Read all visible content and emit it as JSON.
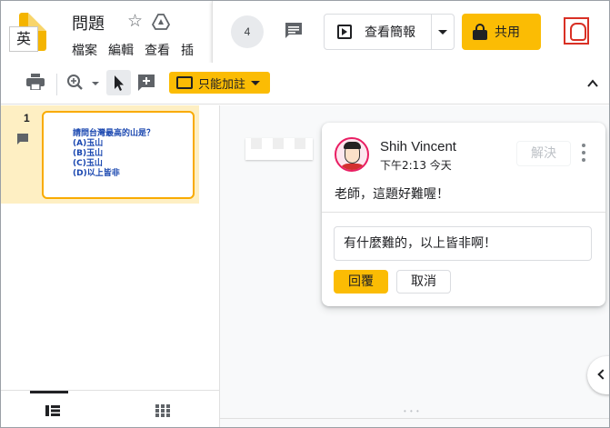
{
  "window": {
    "ime_indicator": "英"
  },
  "header": {
    "doc_title": "問題",
    "menu": [
      "檔案",
      "編輯",
      "查看",
      "插"
    ],
    "viewer_count": "4",
    "present_label": "查看簡報",
    "share_label": "共用"
  },
  "toolbar": {
    "mode_label": "只能加註"
  },
  "filmstrip": {
    "slides": [
      {
        "number": "1",
        "lines": [
          "請問台灣最高的山是？",
          "(A)玉山",
          "(B)玉山",
          "(C)玉山",
          "(D)以上皆非"
        ]
      }
    ]
  },
  "comment": {
    "author": "Shih Vincent",
    "time": "下午2:13 今天",
    "resolve_label": "解決",
    "text": "老師，這題好難喔！",
    "reply_value": "有什麼難的，以上皆非啊！",
    "reply_button": "回覆",
    "cancel_button": "取消"
  },
  "colors": {
    "accent": "#fbbc04",
    "selected_slide_bg": "#feefc3",
    "slide_text": "#1a47b0"
  }
}
